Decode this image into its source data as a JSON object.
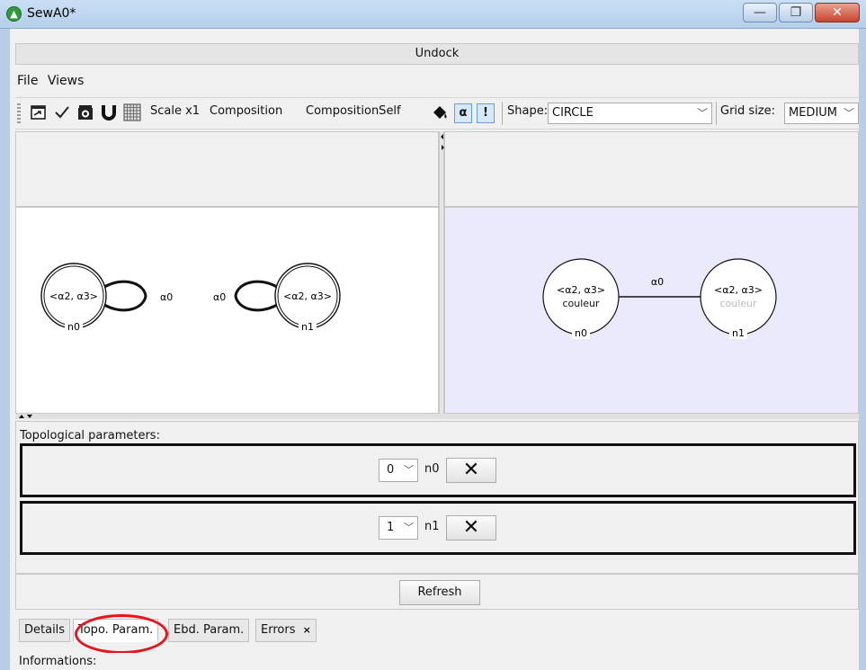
{
  "window": {
    "title": "SewA0*",
    "minimize_icon": "minimize-icon",
    "maximize_icon": "restore-icon",
    "close_icon": "close-icon"
  },
  "undock_label": "Undock",
  "menu": [
    "File",
    "Views"
  ],
  "toolbar": {
    "scale_label": "Scale x1",
    "composition_label": "Composition",
    "composition_self_label": "CompositionSelf",
    "alpha_label": "α",
    "bang_label": "!",
    "shape_label": "Shape:",
    "shape_value": "CIRCLE",
    "grid_label": "Grid size:",
    "grid_value": "MEDIUM"
  },
  "left_graph": {
    "n0": {
      "label": "<α2, α3>",
      "name": "n0",
      "loop_label": "α0"
    },
    "n1": {
      "label": "<α2, α3>",
      "name": "n1",
      "loop_label": "α0"
    }
  },
  "right_graph": {
    "edge_label": "α0",
    "n0": {
      "label": "<α2, α3>",
      "sub": "couleur",
      "name": "n0"
    },
    "n1": {
      "label": "<α2, α3>",
      "sub": "couleur",
      "name": "n1"
    }
  },
  "topo": {
    "title": "Topological parameters:",
    "rows": [
      {
        "value": "0",
        "name": "n0",
        "delete": "✕"
      },
      {
        "value": "1",
        "name": "n1",
        "delete": "✕"
      }
    ],
    "refresh": "Refresh"
  },
  "tabs": [
    {
      "label": "Details",
      "active": false
    },
    {
      "label": "Topo. Param.",
      "active": true
    },
    {
      "label": "Ebd. Param.",
      "active": false
    },
    {
      "label": "Errors",
      "active": false,
      "close": "×"
    }
  ],
  "info_label": "Informations:",
  "colors": {
    "highlight": "#e8131b",
    "right_canvas_bg": "#eaeafc"
  }
}
